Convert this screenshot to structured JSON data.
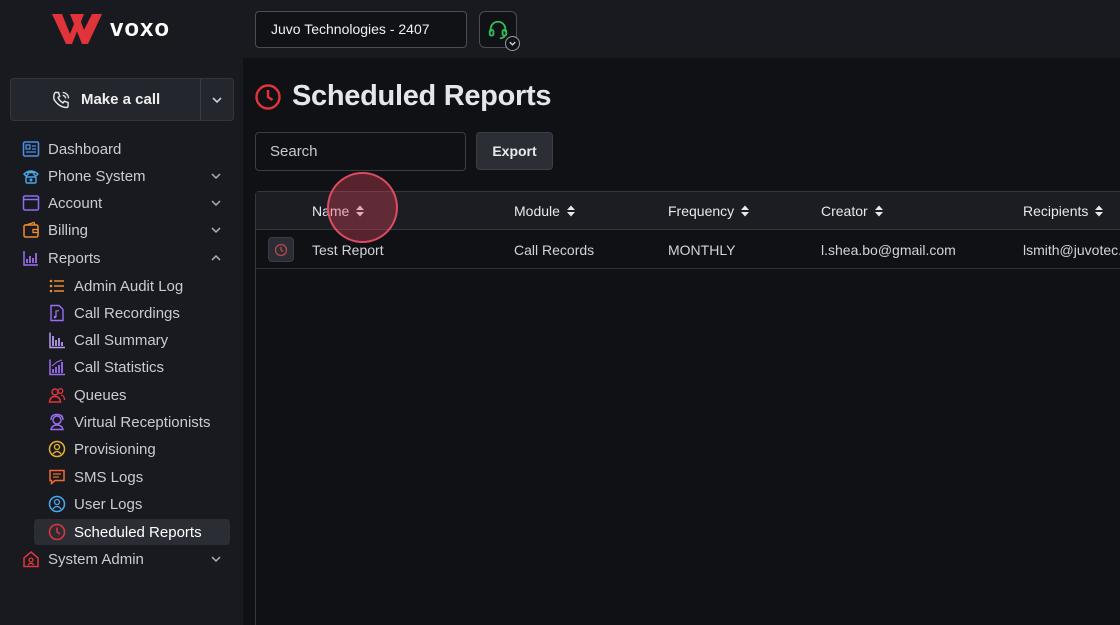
{
  "header": {
    "logo_text": "voxo",
    "company_selector": "Juvo Technologies - 2407",
    "support_icon": "headset-icon"
  },
  "sidebar": {
    "call_button_label": "Make a call",
    "items": [
      {
        "label": "Dashboard",
        "icon": "dashboard-icon",
        "expandable": false
      },
      {
        "label": "Phone System",
        "icon": "phone-icon",
        "expandable": true
      },
      {
        "label": "Account",
        "icon": "window-icon",
        "expandable": true
      },
      {
        "label": "Billing",
        "icon": "wallet-icon",
        "expandable": true
      },
      {
        "label": "Reports",
        "icon": "bar-chart-icon",
        "expandable": true,
        "expanded": true
      },
      {
        "label": "System Admin",
        "icon": "admin-house-icon",
        "expandable": true
      }
    ],
    "report_items": [
      {
        "label": "Admin Audit Log",
        "icon": "list-icon"
      },
      {
        "label": "Call Recordings",
        "icon": "music-file-icon"
      },
      {
        "label": "Call Summary",
        "icon": "bars-icon"
      },
      {
        "label": "Call Statistics",
        "icon": "stats-icon"
      },
      {
        "label": "Queues",
        "icon": "users-icon"
      },
      {
        "label": "Virtual Receptionists",
        "icon": "receptionist-icon"
      },
      {
        "label": "Provisioning",
        "icon": "provisioning-icon"
      },
      {
        "label": "SMS Logs",
        "icon": "message-icon"
      },
      {
        "label": "User Logs",
        "icon": "user-circle-icon"
      },
      {
        "label": "Scheduled Reports",
        "icon": "clock-icon",
        "active": true
      }
    ]
  },
  "main": {
    "title": "Scheduled Reports",
    "search_placeholder": "Search",
    "export_label": "Export",
    "table": {
      "columns": [
        "Name",
        "Module",
        "Frequency",
        "Creator",
        "Recipients"
      ],
      "rows": [
        {
          "name": "Test Report",
          "module": "Call Records",
          "frequency": "MONTHLY",
          "creator": "l.shea.bo@gmail.com",
          "recipients": "lsmith@juvotec."
        }
      ]
    }
  },
  "colors": {
    "accent": "#d9353b",
    "background": "#0f1115",
    "sidebar": "#181a1f",
    "active_item": "#2a2d34"
  }
}
